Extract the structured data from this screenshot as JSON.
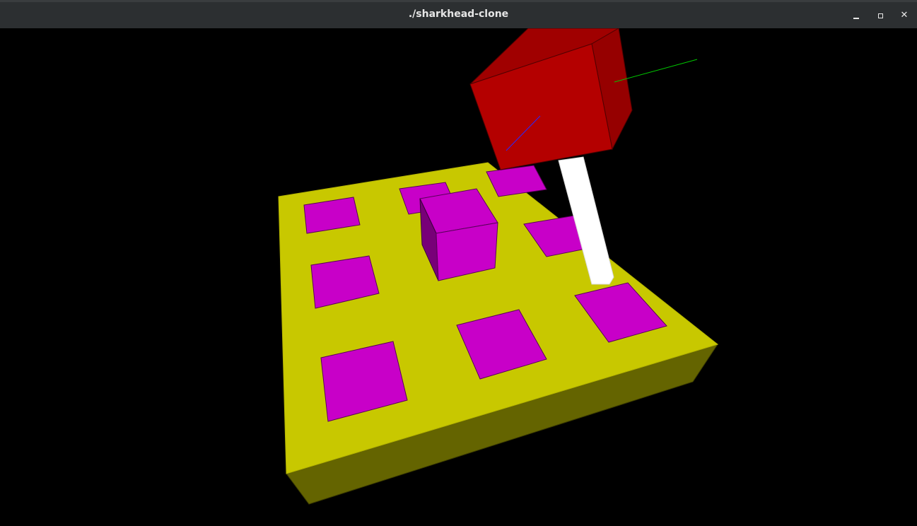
{
  "window": {
    "title": "./sharkhead-clone",
    "controls": {
      "minimize": "minimize",
      "maximize": "maximize",
      "close": "✕"
    }
  },
  "scene": {
    "colors": {
      "background": "#000000",
      "board_top": "#c8c800",
      "board_front": "#646400",
      "tile": "#c800c8",
      "cube_front": "#c800c8",
      "cube_side": "#780078",
      "head_front": "#b40000",
      "head_top": "#a00000",
      "head_side": "#960000",
      "neck": "#ffffff",
      "axis_green": "#00c800",
      "axis_blue": "#2828ff"
    },
    "tiles_count": 9
  }
}
